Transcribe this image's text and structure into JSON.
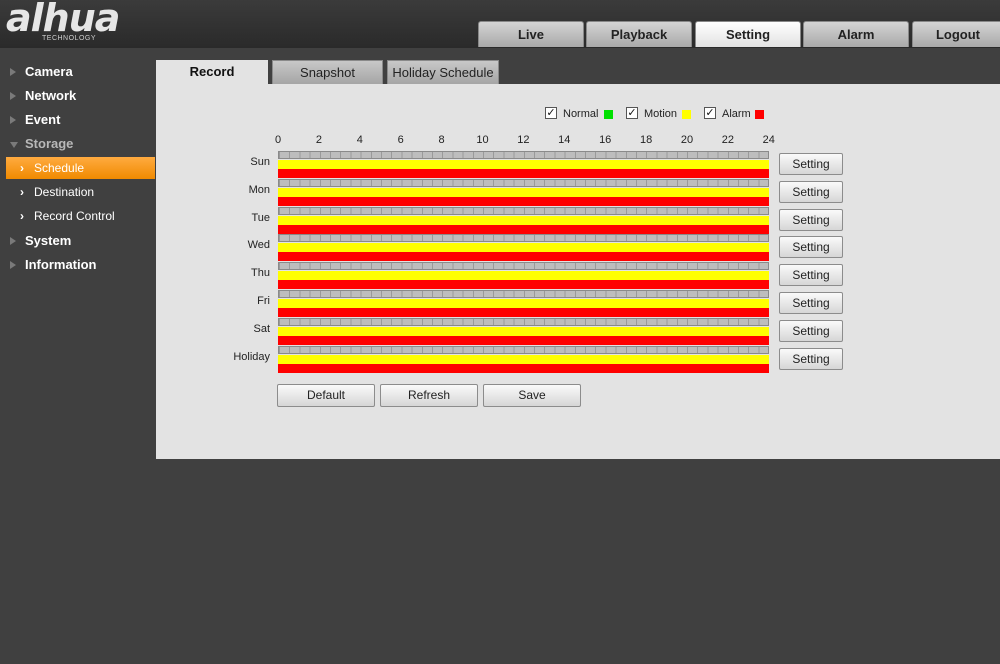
{
  "brand": {
    "logo": "alhua",
    "tagline": "TECHNOLOGY"
  },
  "top_tabs": [
    {
      "label": "Live",
      "active": false
    },
    {
      "label": "Playback",
      "active": false
    },
    {
      "label": "Setting",
      "active": true
    },
    {
      "label": "Alarm",
      "active": false
    },
    {
      "label": "Logout",
      "active": false
    }
  ],
  "sidebar": {
    "items": [
      {
        "label": "Camera"
      },
      {
        "label": "Network"
      },
      {
        "label": "Event"
      },
      {
        "label": "Storage",
        "expanded": true
      },
      {
        "label": "System"
      },
      {
        "label": "Information"
      }
    ],
    "storage_children": [
      {
        "label": "Schedule",
        "active": true
      },
      {
        "label": "Destination",
        "active": false
      },
      {
        "label": "Record Control",
        "active": false
      }
    ]
  },
  "sub_tabs": [
    {
      "label": "Record",
      "active": true
    },
    {
      "label": "Snapshot",
      "active": false
    },
    {
      "label": "Holiday Schedule",
      "active": false
    }
  ],
  "legend": [
    {
      "label": "Normal",
      "checked": true,
      "color": "#00e000"
    },
    {
      "label": "Motion",
      "checked": true,
      "color": "#ffff00"
    },
    {
      "label": "Alarm",
      "checked": true,
      "color": "#ff0000"
    }
  ],
  "hours": [
    "0",
    "2",
    "4",
    "6",
    "8",
    "10",
    "12",
    "14",
    "16",
    "18",
    "20",
    "22",
    "24"
  ],
  "days": [
    "Sun",
    "Mon",
    "Tue",
    "Wed",
    "Thu",
    "Fri",
    "Sat",
    "Holiday"
  ],
  "row_button_label": "Setting",
  "bar_colors": {
    "motion": "#ffff00",
    "alarm": "#ff0000"
  },
  "actions": {
    "default": "Default",
    "refresh": "Refresh",
    "save": "Save"
  }
}
